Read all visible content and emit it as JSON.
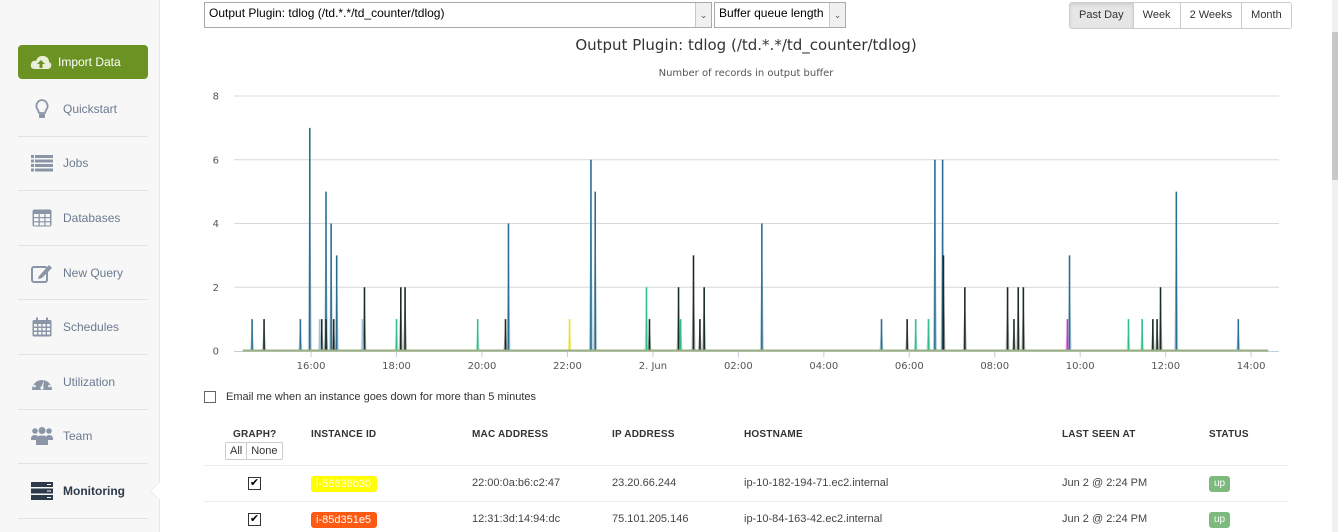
{
  "sidebar": {
    "import_label": "Import Data",
    "items": [
      {
        "label": "Quickstart",
        "icon": "lightbulb-icon"
      },
      {
        "label": "Jobs",
        "icon": "list-icon"
      },
      {
        "label": "Databases",
        "icon": "table-icon"
      },
      {
        "label": "New Query",
        "icon": "edit-icon"
      },
      {
        "label": "Schedules",
        "icon": "calendar-icon"
      },
      {
        "label": "Utilization",
        "icon": "dashboard-icon"
      },
      {
        "label": "Team",
        "icon": "users-icon"
      },
      {
        "label": "Monitoring",
        "icon": "server-icon",
        "active": true
      }
    ]
  },
  "toolbar": {
    "plugin_select": "Output Plugin: tdlog (/td.*.*/td_counter/tdlog)",
    "metric_select": "Buffer queue length",
    "ranges": [
      "Past Day",
      "Week",
      "2 Weeks",
      "Month"
    ],
    "active_range": "Past Day"
  },
  "chart_data": {
    "type": "line",
    "title": "Output Plugin: tdlog (/td.*.*/td_counter/tdlog)",
    "subtitle": "Number of records in output buffer",
    "xlabel": "",
    "ylabel": "",
    "ylim": [
      0,
      8
    ],
    "yticks": [
      0,
      2,
      4,
      6,
      8
    ],
    "xticks": [
      "16:00",
      "18:00",
      "20:00",
      "22:00",
      "2. Jun",
      "02:00",
      "04:00",
      "06:00",
      "08:00",
      "10:00",
      "12:00",
      "14:00"
    ],
    "x_unit": "hours since Jun 1 14:00",
    "xlim": [
      0.4,
      24.4
    ],
    "grid": true,
    "baseline_color": "#9bb07a",
    "series": [
      {
        "name": "blue",
        "color": "#2a6f93",
        "points": [
          [
            0.62,
            1
          ],
          [
            1.75,
            1
          ],
          [
            1.97,
            7
          ],
          [
            2.35,
            5
          ],
          [
            2.47,
            4
          ],
          [
            2.6,
            3
          ],
          [
            6.62,
            4
          ],
          [
            8.55,
            6
          ],
          [
            8.65,
            5
          ],
          [
            12.55,
            4
          ],
          [
            15.35,
            1
          ],
          [
            16.6,
            6
          ],
          [
            16.78,
            6
          ],
          [
            19.75,
            3
          ],
          [
            22.25,
            5
          ],
          [
            23.7,
            1
          ]
        ]
      },
      {
        "name": "dark",
        "color": "#1c2b24",
        "points": [
          [
            0.9,
            1
          ],
          [
            2.25,
            1
          ],
          [
            2.35,
            1
          ],
          [
            2.53,
            1
          ],
          [
            3.25,
            2
          ],
          [
            4.1,
            2
          ],
          [
            4.2,
            2
          ],
          [
            6.55,
            1
          ],
          [
            9.92,
            1
          ],
          [
            10.6,
            2
          ],
          [
            10.95,
            3
          ],
          [
            11.1,
            1
          ],
          [
            11.2,
            2
          ],
          [
            15.95,
            1
          ],
          [
            16.8,
            3
          ],
          [
            17.3,
            2
          ],
          [
            18.3,
            2
          ],
          [
            18.45,
            1
          ],
          [
            18.55,
            2
          ],
          [
            18.67,
            2
          ],
          [
            21.7,
            1
          ],
          [
            21.8,
            1
          ],
          [
            21.88,
            2
          ]
        ]
      },
      {
        "name": "lightblue",
        "color": "#9fc6d8",
        "points": [
          [
            2.2,
            1
          ],
          [
            3.2,
            1
          ],
          [
            16.45,
            1
          ]
        ]
      },
      {
        "name": "teal",
        "color": "#2fbf8a",
        "points": [
          [
            4.0,
            1
          ],
          [
            5.9,
            1
          ],
          [
            9.85,
            2
          ],
          [
            10.65,
            1
          ],
          [
            16.15,
            1
          ],
          [
            16.45,
            1
          ],
          [
            21.13,
            1
          ],
          [
            21.45,
            1
          ]
        ]
      },
      {
        "name": "yellow",
        "color": "#e4e416",
        "points": [
          [
            8.05,
            1
          ]
        ]
      },
      {
        "name": "magenta",
        "color": "#cc33cc",
        "points": [
          [
            19.7,
            1
          ]
        ]
      }
    ]
  },
  "email_alert": {
    "label": "Email me when an instance goes down for more than 5 minutes",
    "checked": false
  },
  "table": {
    "headers": {
      "graph": "GRAPH?",
      "instance_id": "INSTANCE ID",
      "mac": "MAC ADDRESS",
      "ip": "IP ADDRESS",
      "hostname": "HOSTNAME",
      "last_seen": "LAST SEEN AT",
      "status": "STATUS"
    },
    "all_label": "All",
    "none_label": "None",
    "rows": [
      {
        "graph": true,
        "instance_id": "i-56636b30",
        "color": "#ffff00",
        "mac": "22:00:0a:b6:c2:47",
        "ip": "23.20.66.244",
        "hostname": "ip-10-182-194-71.ec2.internal",
        "last_seen": "Jun 2 @ 2:24 PM",
        "status": "up"
      },
      {
        "graph": true,
        "instance_id": "i-85d351e5",
        "color": "#ff5a14",
        "mac": "12:31:3d:14:94:dc",
        "ip": "75.101.205.146",
        "hostname": "ip-10-84-163-42.ec2.internal",
        "last_seen": "Jun 2 @ 2:24 PM",
        "status": "up"
      }
    ]
  }
}
